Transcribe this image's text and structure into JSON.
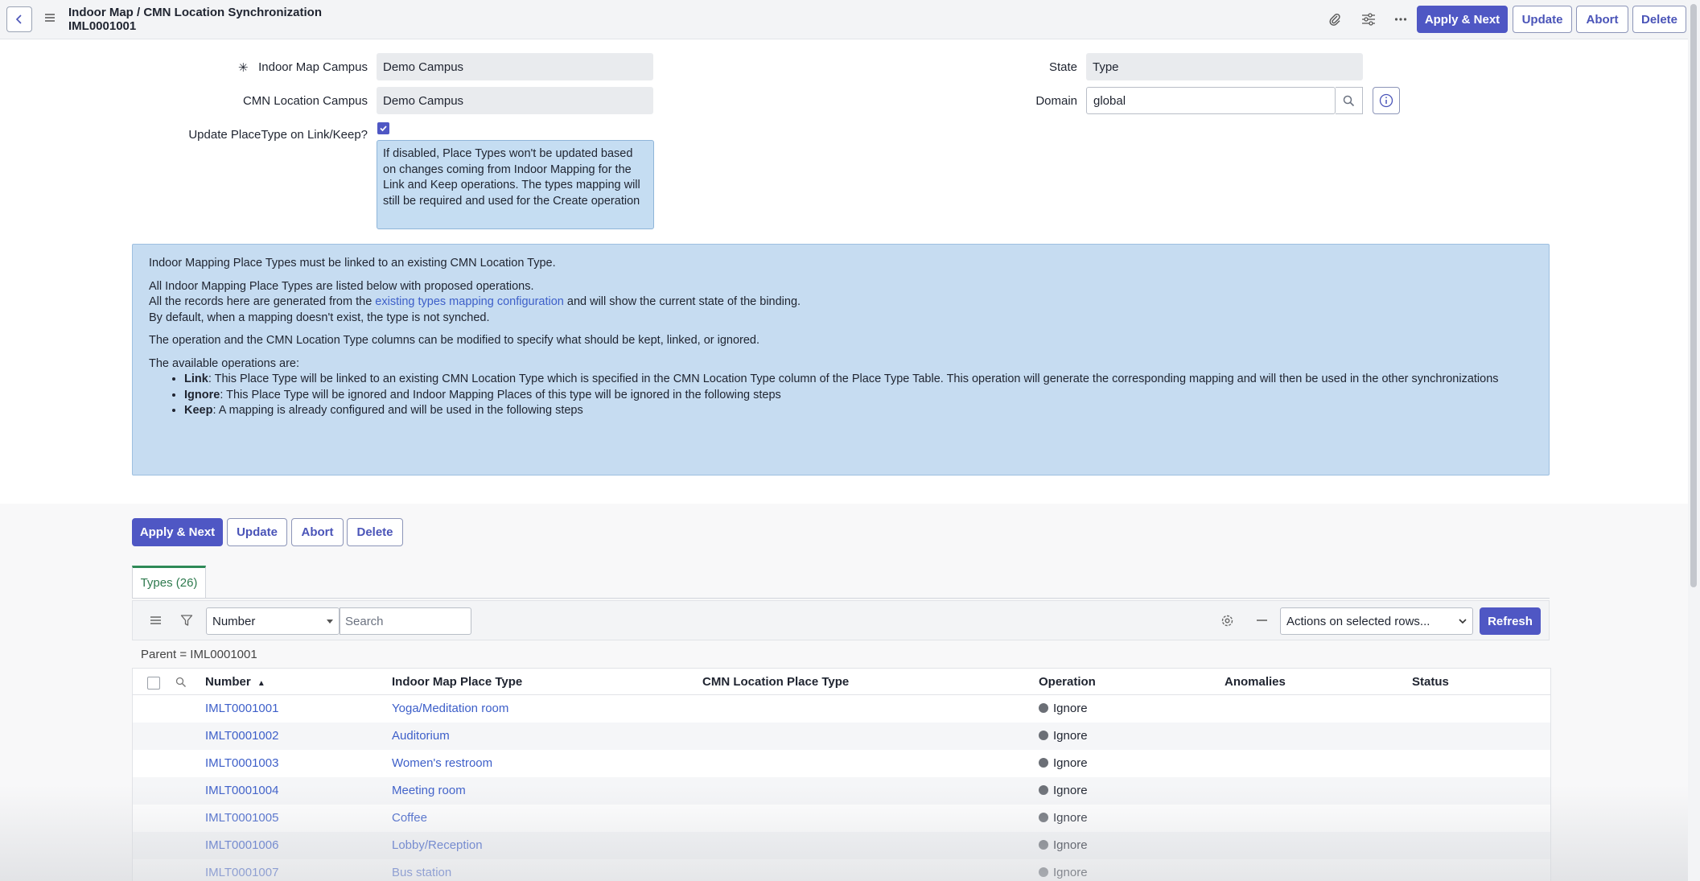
{
  "header": {
    "title_line1": "Indoor Map / CMN Location Synchronization",
    "title_line2": "IML0001001",
    "icons": [
      "back-icon",
      "menu-icon",
      "paperclip-icon",
      "sliders-icon",
      "more-icon"
    ],
    "buttons": {
      "apply_next": "Apply & Next",
      "update": "Update",
      "abort": "Abort",
      "delete": "Delete"
    }
  },
  "form": {
    "required_mark": "✳",
    "indoor_map_campus": {
      "label": "Indoor Map Campus",
      "value": "Demo Campus"
    },
    "cmn_location_campus": {
      "label": "CMN Location Campus",
      "value": "Demo Campus"
    },
    "update_placetype": {
      "label": "Update PlaceType on Link/Keep?",
      "checked": true,
      "tooltip": "If disabled, Place Types won't be updated based on changes coming from Indoor Mapping for the Link and Keep operations. The types mapping will still be required and used for the Create operation"
    },
    "state": {
      "label": "State",
      "value": "Type"
    },
    "domain": {
      "label": "Domain",
      "value": "global"
    }
  },
  "info": {
    "p1": "Indoor Mapping Place Types must be linked to an existing CMN Location Type.",
    "p2a": "All Indoor Mapping Place Types are listed below with proposed operations.",
    "p2b_pre": "All the records here are generated from the ",
    "p2b_link": "existing types mapping configuration",
    "p2b_post": " and will show the current state of the binding.",
    "p2c": "By default, when a mapping doesn't exist, the type is not synched.",
    "p3": "The operation and the CMN Location Type columns can be modified to specify what should be kept, linked, or ignored.",
    "p4": "The available operations are:",
    "ops": [
      {
        "name": "Link",
        "desc": ": This Place Type will be linked to an existing CMN Location Type which is specified in the CMN Location Type column of the Place Type Table. This operation will generate the corresponding mapping and will then be used in the other synchronizations"
      },
      {
        "name": "Ignore",
        "desc": ": This Place Type will be ignored and Indoor Mapping Places of this type will be ignored in the following steps"
      },
      {
        "name": "Keep",
        "desc": ": A mapping is already configured and will be used in the following steps"
      }
    ]
  },
  "footer_buttons": {
    "apply_next": "Apply & Next",
    "update": "Update",
    "abort": "Abort",
    "delete": "Delete"
  },
  "related_list": {
    "tab_label": "Types (26)",
    "filter_field": "Number",
    "search_placeholder": "Search",
    "actions_select": "Actions on selected rows...",
    "refresh": "Refresh",
    "breadcrumb": "Parent = IML0001001",
    "columns": {
      "number": "Number",
      "indoor_type": "Indoor Map Place Type",
      "cmn_type": "CMN Location Place Type",
      "operation": "Operation",
      "anomalies": "Anomalies",
      "status": "Status"
    },
    "sort_indicator": "▲",
    "rows": [
      {
        "number": "IMLT0001001",
        "indoor_type": "Yoga/Meditation room",
        "cmn_type": "",
        "operation": "Ignore",
        "anomalies": "",
        "status": ""
      },
      {
        "number": "IMLT0001002",
        "indoor_type": "Auditorium",
        "cmn_type": "",
        "operation": "Ignore",
        "anomalies": "",
        "status": ""
      },
      {
        "number": "IMLT0001003",
        "indoor_type": "Women's restroom",
        "cmn_type": "",
        "operation": "Ignore",
        "anomalies": "",
        "status": ""
      },
      {
        "number": "IMLT0001004",
        "indoor_type": "Meeting room",
        "cmn_type": "",
        "operation": "Ignore",
        "anomalies": "",
        "status": ""
      },
      {
        "number": "IMLT0001005",
        "indoor_type": "Coffee",
        "cmn_type": "",
        "operation": "Ignore",
        "anomalies": "",
        "status": ""
      },
      {
        "number": "IMLT0001006",
        "indoor_type": "Lobby/Reception",
        "cmn_type": "",
        "operation": "Ignore",
        "anomalies": "",
        "status": ""
      },
      {
        "number": "IMLT0001007",
        "indoor_type": "Bus station",
        "cmn_type": "",
        "operation": "Ignore",
        "anomalies": "",
        "status": ""
      }
    ]
  },
  "colors": {
    "primary": "#4f57c4",
    "link": "#3d5fc9",
    "info_bg": "#c6dcf1",
    "tab_accent": "#2e8a57",
    "status_dot": "#6b6f76"
  }
}
